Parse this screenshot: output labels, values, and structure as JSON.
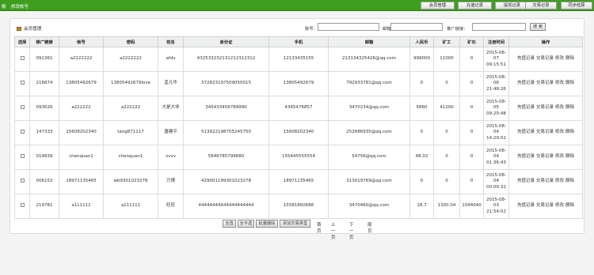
{
  "topbar": {
    "left_links": [
      "概",
      "修改帐号"
    ],
    "buttons": [
      "会员管理",
      "充值记录",
      "提现记录",
      "交易记录",
      "同步结算"
    ]
  },
  "panel": {
    "title": "会员管理",
    "search": {
      "account_label": "账号：",
      "email_label": "邮箱：",
      "promo_label": "推广链接：",
      "button": "搜 索",
      "account_value": "",
      "email_value": "",
      "promo_value": ""
    }
  },
  "table": {
    "headers": [
      "选择",
      "推广链接",
      "帐号",
      "密码",
      "姓名",
      "身份证",
      "手机",
      "邮箱",
      "人民币",
      "矿工",
      "矿石",
      "注册时间",
      "操作"
    ],
    "rows": [
      {
        "promo": "091361",
        "account": "a2222222",
        "password": "a2222222",
        "name": "afds",
        "idcard": "432533232131212312312",
        "phone": "12133435155",
        "email": "213134325426@qq.com",
        "rmb": "999000",
        "miner": "11000",
        "ore": "0",
        "date": "2015-08-07",
        "time": "09:15:51"
      },
      {
        "promo": "216874",
        "account": "13805492679",
        "password": "13805492679love",
        "name": "孟凡华",
        "idcard": "372823197509050015",
        "phone": "13805492679",
        "email": "792933781@qq.com",
        "rmb": "0",
        "miner": "0",
        "ore": "0",
        "date": "2015-08-06",
        "time": "21:48:26"
      },
      {
        "promo": "093026",
        "account": "a222222",
        "password": "a222222",
        "name": "大是大非",
        "idcard": "345433456789990",
        "phone": "4365476857",
        "email": "3470234@qq.com",
        "rmb": "5880",
        "miner": "41200",
        "ore": "0",
        "date": "2015-08-05",
        "time": "09:20:48"
      },
      {
        "promo": "147333",
        "account": "15608202340",
        "password": "tang871117",
        "name": "唐建平",
        "idcard": "513922198705245750",
        "phone": "15608202340",
        "email": "252686935@qq.com",
        "rmb": "0",
        "miner": "0",
        "ore": "0",
        "date": "2015-08-04",
        "time": "14:29:02"
      },
      {
        "promo": "014839",
        "account": "chenquan1",
        "password": "chenquan1",
        "name": "vvvv",
        "idcard": "5646785799680",
        "phone": "155445555554",
        "email": "54756@qq.com",
        "rmb": "48.02",
        "miner": "0",
        "ore": "0",
        "date": "2015-08-04",
        "time": "01:36:43"
      },
      {
        "promo": "006152",
        "account": "18971135465",
        "password": "wb9301023278",
        "name": "万博",
        "idcard": "429001199301023278",
        "phone": "18971135465",
        "email": "313019769@qq.com",
        "rmb": "0",
        "miner": "0",
        "ore": "0",
        "date": "2015-08-04",
        "time": "00:00:32"
      },
      {
        "promo": "219781",
        "account": "a111111",
        "password": "a111111",
        "name": "旺旺",
        "idcard": "44444444444444444444",
        "phone": "15581660686",
        "email": "3470460@qq.com",
        "rmb": "18.7",
        "miner": "1300.04",
        "ore": "1044040",
        "date": "2015-08-03",
        "time": "21:54:02"
      }
    ],
    "ops": [
      "充值记录",
      "交易记录",
      "修改",
      "删除"
    ]
  },
  "footer": {
    "buttons": [
      "全选",
      "全不选",
      "批量删除",
      "添加交易类型"
    ],
    "pagination": [
      "首页",
      "上一页",
      "下一页",
      "尾页"
    ]
  },
  "colors": {
    "topbar": "#3e9f1e",
    "header_bg": "#eef0ef",
    "border": "#d0d0d0"
  }
}
